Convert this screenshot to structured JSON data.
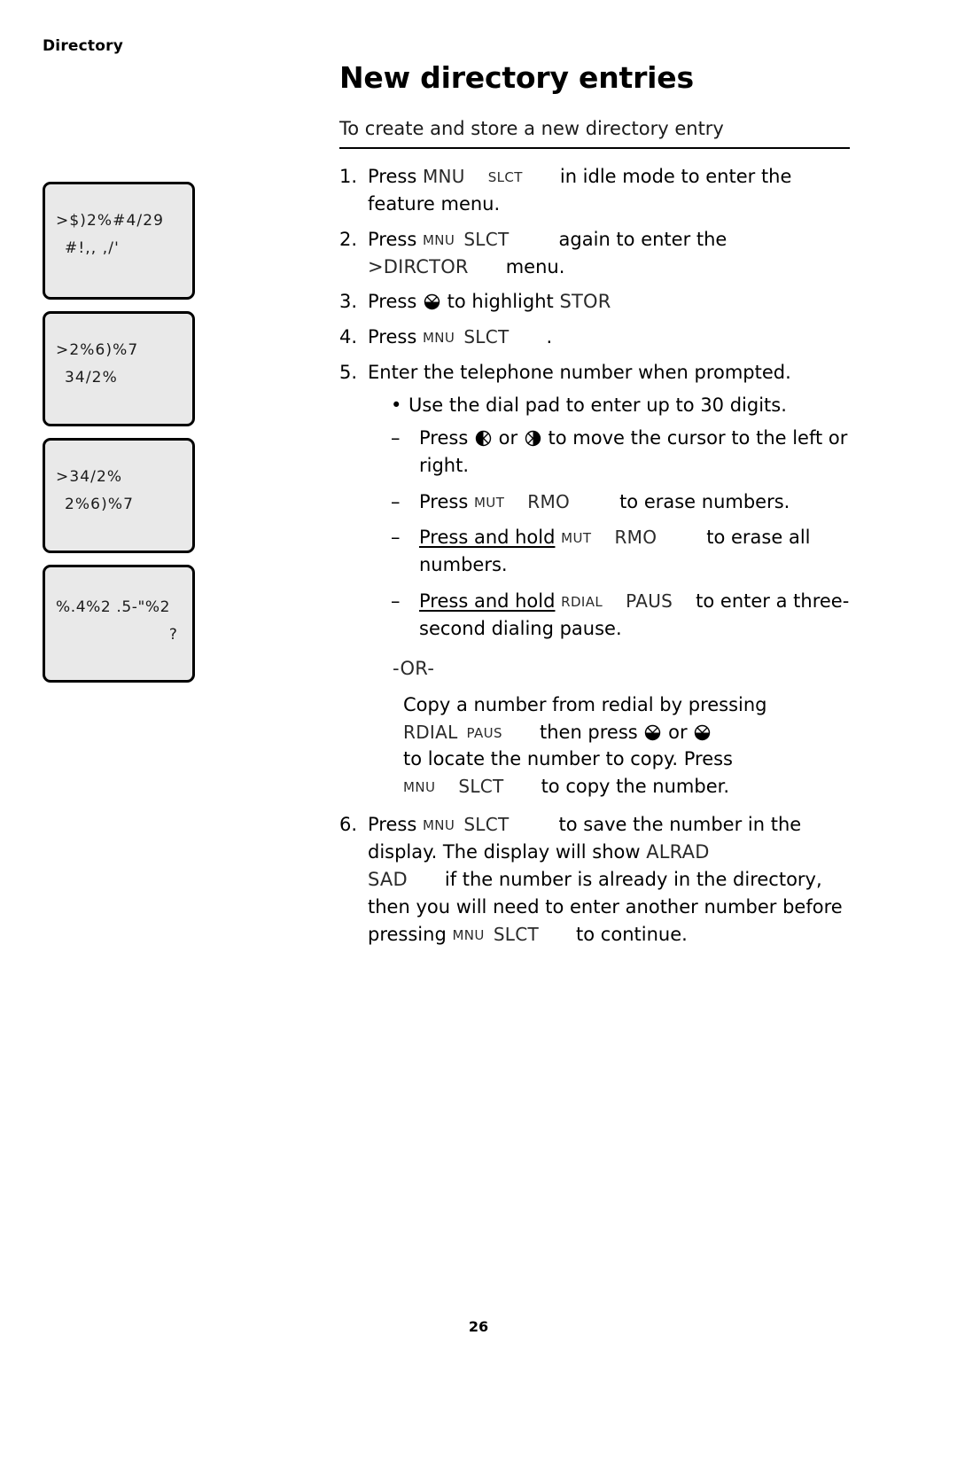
{
  "running_head": "Directory",
  "page_number": "26",
  "title": "New directory entries",
  "subhead": "To create and store a new directory entry",
  "lcd_screens": [
    {
      "id": "lcd-directory-call-log",
      "line1": ">$)2%#4/29",
      "line2": "#!,, ,/'"
    },
    {
      "id": "lcd-review-store",
      "line1": ">2%6)%7",
      "line2": "34/2%"
    },
    {
      "id": "lcd-store-review",
      "line1": ">34/2%",
      "line2": "2%6)%7"
    },
    {
      "id": "lcd-enter-number",
      "line1": "%.4%2 .5-\"%2",
      "line2": "?"
    }
  ],
  "keys": {
    "mnu": "MNU",
    "slct": "SLCT",
    "mut": "MUT",
    "rmo": "RMO",
    "rdial": "RDIAL",
    "paus": "PAUS"
  },
  "display_words": {
    "dirctor": ">DIRCTOR",
    "stor": "STOR",
    "alrad": "ALRAD",
    "sad": "SAD"
  },
  "steps": [
    {
      "num": "1.",
      "lead": "Press",
      "tail": "in idle mode to enter the feature menu."
    },
    {
      "num": "2.",
      "lead": "Press",
      "mid": "again to enter the",
      "tail": "menu."
    },
    {
      "num": "3.",
      "lead": "Press",
      "mid": "to highlight",
      "tail": ""
    },
    {
      "num": "4.",
      "lead": "Press",
      "tail": "."
    },
    {
      "num": "5.",
      "lead": "Enter the telephone number when prompted.",
      "bullet": "Use the dial pad to enter up to 30 digits.",
      "dashes": [
        {
          "pre": "Press",
          "mid": "or",
          "post": "to move the cursor to the left or right."
        },
        {
          "pre": "Press",
          "post": "to erase numbers."
        },
        {
          "pre": "Press and hold",
          "post": "to erase all numbers."
        },
        {
          "pre": "Press and hold",
          "post": "to enter a three-second dialing pause."
        }
      ],
      "or_label": "-OR-",
      "or_line1": "Copy a number from redial by pressing",
      "or_line2_mid": "then press",
      "or_line2_or": "or",
      "or_line3": "to locate the number to copy. Press",
      "or_line4": "to copy the number."
    },
    {
      "num": "6.",
      "lead": "Press",
      "part1": "to save the number in the display. The display will show",
      "part2": "if the number is already in the directory, then you will need to enter another number before pressing",
      "part3": "to continue."
    }
  ],
  "marks": {
    "bullet": "•",
    "dash": "–",
    "or_conj": "or"
  },
  "colors": {
    "lcd_fill": "#e9e9e9",
    "lcd_border": "#000000",
    "text": "#000000",
    "key_text": "#2a2a2a"
  }
}
